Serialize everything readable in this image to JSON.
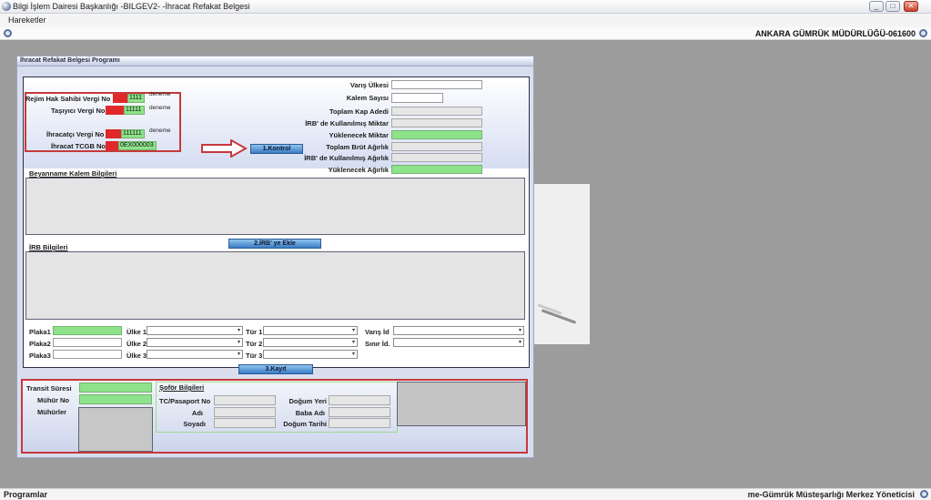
{
  "window": {
    "title": "Bilgi İşlem Dairesi Başkanlığı -BILGEV2- -İhracat Refakat Belgesi",
    "controls": {
      "minimize": "_",
      "maximize": "□",
      "close": "✕"
    }
  },
  "menu": {
    "hareketler": "Hareketler"
  },
  "header": {
    "customs_office": "ANKARA GÜMRÜK MÜDÜRLÜĞÜ-061600"
  },
  "status": {
    "left": "Programlar",
    "right": "me-Gümrük Müsteşarlığı Merkez Yöneticisi"
  },
  "form": {
    "title": "İhracat Refakat Belgesi Programı",
    "left_fields": {
      "rejim_label": "Rejim Hak Sahibi Vergi No",
      "rejim_value": "1111",
      "rejim_note": "deneme",
      "tasiyici_label": "Taşıyıcı Vergi No",
      "tasiyici_value": "11111",
      "tasiyici_note": "deneme",
      "ihracatci_label": "İhracatçı Vergi No",
      "ihracatci_value": "111111",
      "ihracatci_note": "deneme",
      "tcgb_label": "İhracat TCGB No",
      "tcgb_value": "0EX000003"
    },
    "right_fields": {
      "varis_ulkesi": "Varış Ülkesi",
      "kalem_sayisi": "Kalem Sayısı",
      "toplam_kap_adedi": "Toplam Kap Adedi",
      "irb_kullanilmis_miktar": "İRB' de Kullanılmış Miktar",
      "yuklenecek_miktar": "Yüklenecek Miktar",
      "toplam_brut_agirlik": "Toplam Brüt Ağırlık",
      "irb_kullanilmis_agirlik": "İRB' de Kullanılmış Ağırlık",
      "yuklenecek_agirlik": "Yüklenecek Ağırlık"
    },
    "buttons": {
      "kontrol": "1.Kontrol",
      "irb_ekle": "2.İRB' ye Ekle",
      "kayit": "3.Kayıt"
    },
    "sections": {
      "beyanname": "Beyanname Kalem Bilgileri",
      "irb": "İRB Bilgileri",
      "sofor": "Şoför Bilgileri"
    },
    "vehicle": {
      "plaka1": "Plaka1",
      "plaka2": "Plaka2",
      "plaka3": "Plaka3",
      "ulke1": "Ülke 1",
      "ulke2": "Ülke 2",
      "ulke3": "Ülke 3",
      "tur1": "Tür 1",
      "tur2": "Tür 2",
      "tur3": "Tür 3",
      "varis_id": "Varış İd",
      "sinir_id": "Sınır İd."
    },
    "bottom": {
      "transit_suresi": "Transit Süresi",
      "muhur_no": "Mühür No",
      "muhurler": "Mühürler",
      "tc_pasaport": "TC/Pasaport No",
      "adi": "Adı",
      "soyadi": "Soyadı",
      "dogum_yeri": "Doğum Yeri",
      "baba_adi": "Baba Adı",
      "dogum_tarihi": "Doğum Tarihi"
    }
  },
  "colors": {
    "required_red": "#e0282b",
    "filled_green": "#8ee38a",
    "button_blue": "#3a7cc5",
    "frame_red": "#c6393b"
  },
  "icons": {
    "app": "app-globe-icon",
    "gear": "gear-icon",
    "combo": "chevron-down-icon"
  }
}
